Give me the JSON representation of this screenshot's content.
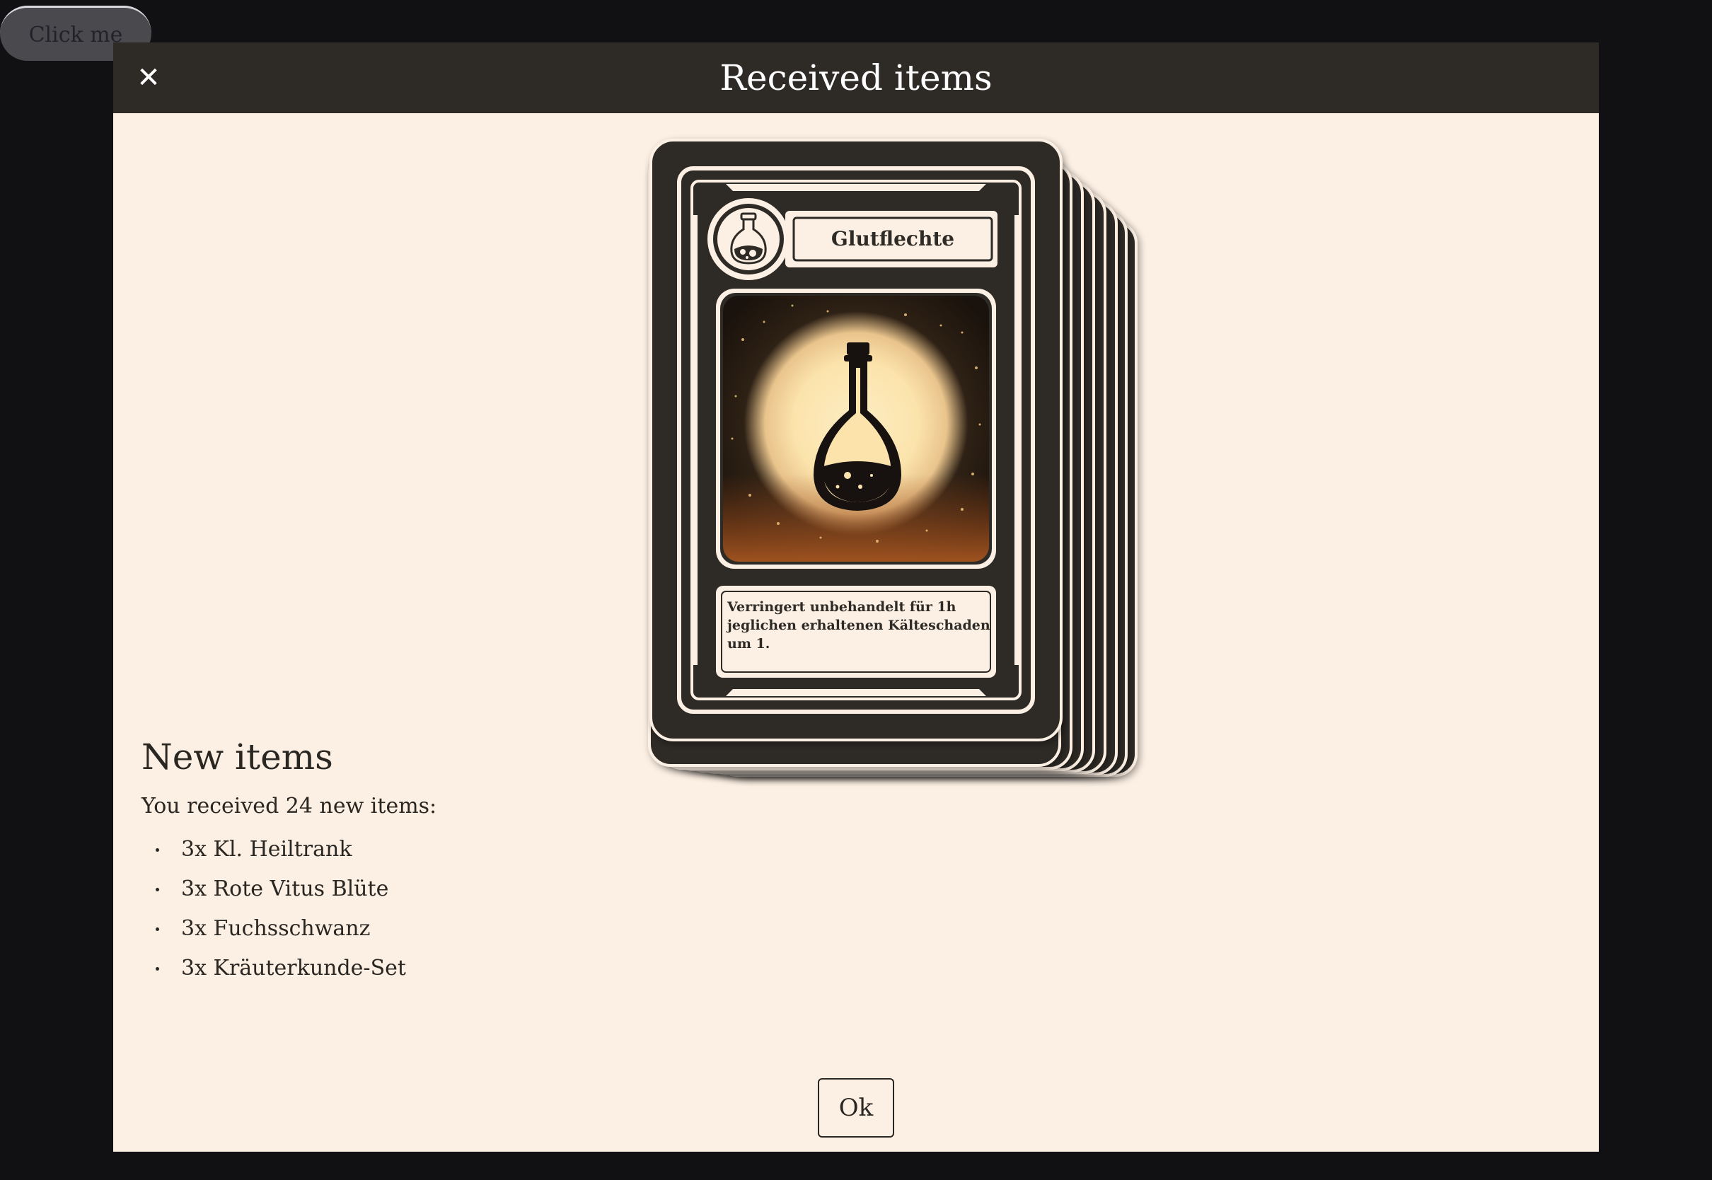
{
  "background_button": {
    "label": "Click me"
  },
  "modal": {
    "title": "Received items",
    "close_icon": "close-icon",
    "ok_label": "Ok"
  },
  "card": {
    "name": "Glutflechte",
    "type_icon": "potion-flask-icon",
    "art": "potion-bottle-illustration",
    "description": "Verringert unbehandelt für 1h jeglichen erhaltenen Kälteschaden um 1.",
    "description_lines": [
      "Verringert unbehandelt für 1h",
      "jeglichen erhaltenen Kälteschaden",
      "um 1."
    ]
  },
  "stack": {
    "cards_visible": 9
  },
  "new_items": {
    "heading": "New items",
    "summary": "You received 24 new items:",
    "items": [
      "3x Kl. Heiltrank",
      "3x Rote Vitus Blüte",
      "3x Fuchsschwanz",
      "3x Kräuterkunde-Set"
    ]
  },
  "colors": {
    "page_bg": "#111113",
    "modal_bg": "#fcefe3",
    "header_bg": "#2e2b27",
    "card_dark": "#2e2b27",
    "card_light": "#fcefe3",
    "art_glow": "#fbe6b4",
    "art_ember": "#9a4a1a"
  }
}
